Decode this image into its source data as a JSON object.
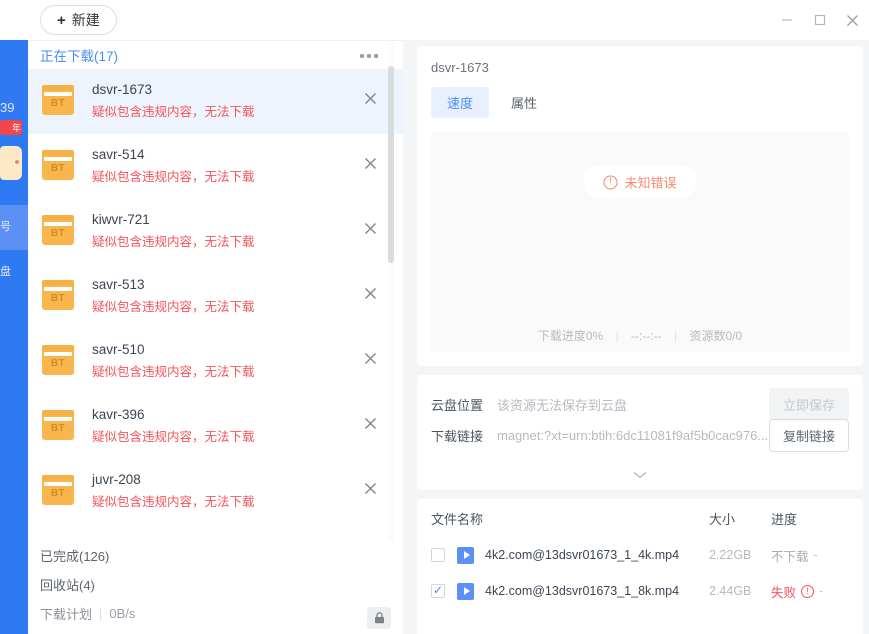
{
  "titlebar": {
    "new_button": "新建",
    "plus_icon": "+",
    "minimize": "minimize-icon",
    "maximize": "maximize-icon",
    "close": "close-icon"
  },
  "rail": {
    "badge_number": "39",
    "badge_label": "年"
  },
  "download_list": {
    "section_title": "正在下载(17)",
    "warn_text": "疑似包含违规内容，无法下载",
    "items": [
      {
        "name": "dsvr-1673",
        "warn": "疑似包含违规内容，无法下载",
        "type": "BT"
      },
      {
        "name": "savr-514",
        "warn": "疑似包含违规内容，无法下载",
        "type": "BT"
      },
      {
        "name": "kiwvr-721",
        "warn": "疑似包含违规内容，无法下载",
        "type": "BT"
      },
      {
        "name": "savr-513",
        "warn": "疑似包含违规内容，无法下载",
        "type": "BT"
      },
      {
        "name": "savr-510",
        "warn": "疑似包含违规内容，无法下载",
        "type": "BT"
      },
      {
        "name": "kavr-396",
        "warn": "疑似包含违规内容，无法下载",
        "type": "BT"
      },
      {
        "name": "juvr-208",
        "warn": "疑似包含违规内容，无法下载",
        "type": "BT"
      }
    ],
    "bottom_nav": [
      {
        "label": "已完成(126)"
      },
      {
        "label": "回收站(4)"
      }
    ],
    "plan_label": "下载计划",
    "plan_speed": "0B/s"
  },
  "detail": {
    "title": "dsvr-1673",
    "tabs": [
      {
        "label": "速度",
        "active": true
      },
      {
        "label": "属性",
        "active": false
      }
    ],
    "error_badge": "未知错误",
    "progress_text": "下载进度0%",
    "time_text": "--:--:--",
    "peers_text": "资源数0/0"
  },
  "meta": {
    "cloud_label": "云盘位置",
    "cloud_value": "该资源无法保存到云盘",
    "save_button": "立即保存",
    "link_label": "下载链接",
    "link_value": "magnet:?xt=urn:btih:6dc11081f9af5b0cac976...",
    "copy_button": "复制链接"
  },
  "file_table": {
    "headers": {
      "name": "文件名称",
      "size": "大小",
      "progress": "进度"
    },
    "rows": [
      {
        "checked": false,
        "name": "4k2.com@13dsvr01673_1_4k.mp4",
        "size": "2.22GB",
        "progress": "不下载",
        "progress_state": "skip",
        "trailing": "-"
      },
      {
        "checked": true,
        "name": "4k2.com@13dsvr01673_1_8k.mp4",
        "size": "2.44GB",
        "progress": "失败",
        "progress_state": "failed",
        "trailing": "-"
      }
    ]
  },
  "colors": {
    "accent_blue": "#4a8ef5",
    "rail_blue": "#2f79f2",
    "warn_red": "#f5545b",
    "error_orange": "#f58a6e",
    "folder_orange": "#f8b64c"
  }
}
